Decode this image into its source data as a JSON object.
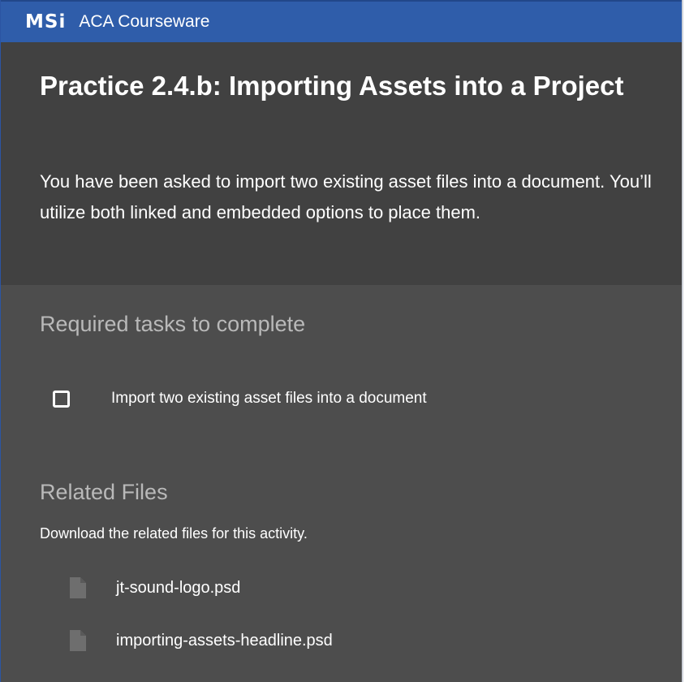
{
  "topbar": {
    "logo_text": "MSi",
    "app_title": "ACA Courseware"
  },
  "header": {
    "title": "Practice 2.4.b: Importing Assets into a Project",
    "description": "You have been asked to import two existing asset files into a document. You’ll utilize both linked and embedded options to place them."
  },
  "required_tasks": {
    "heading": "Required tasks to complete",
    "tasks": [
      {
        "label": "Import two existing asset files into a document",
        "checked": false
      }
    ]
  },
  "related_files": {
    "heading": "Related Files",
    "subheading": "Download the related files for this activity.",
    "files": [
      {
        "name": "jt-sound-logo.psd",
        "icon": "file-icon"
      },
      {
        "name": "importing-assets-headline.psd",
        "icon": "file-icon"
      }
    ]
  },
  "colors": {
    "topbar": "#2f5daa",
    "header_bg": "#414141",
    "content_bg": "#4d4d4d",
    "muted_heading": "#b9b9b9",
    "file_icon": "#6e6e6e"
  }
}
